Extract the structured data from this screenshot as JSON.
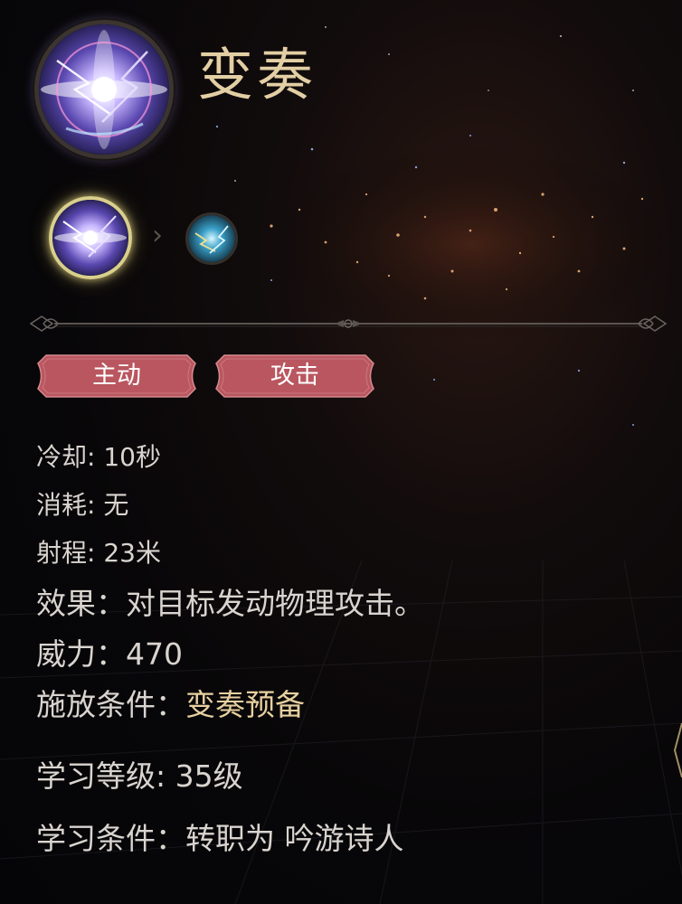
{
  "skill": {
    "name": "变奏",
    "main_icon": "lightning-orb-icon",
    "chain": {
      "current_icon": "lightning-orb-icon",
      "next_icon": "cyan-orb-icon"
    }
  },
  "tags": [
    {
      "label": "主动"
    },
    {
      "label": "攻击"
    }
  ],
  "stats": {
    "cooldown": "冷却: 10秒",
    "cost": "消耗: 无",
    "range": "射程: 23米",
    "effect": "效果：对目标发动物理攻击。",
    "power": "威力：470",
    "condition_label": "施放条件：",
    "condition_value": "变奏预备",
    "learn_level": "学习等级:  35级",
    "learn_requirement": "学习条件：转职为 吟游诗人"
  },
  "colors": {
    "title_gold": "#e3cfa4",
    "highlight_gold": "#e7d0a0",
    "tag_red": "#b9565f",
    "text": "#d9d4cf"
  }
}
